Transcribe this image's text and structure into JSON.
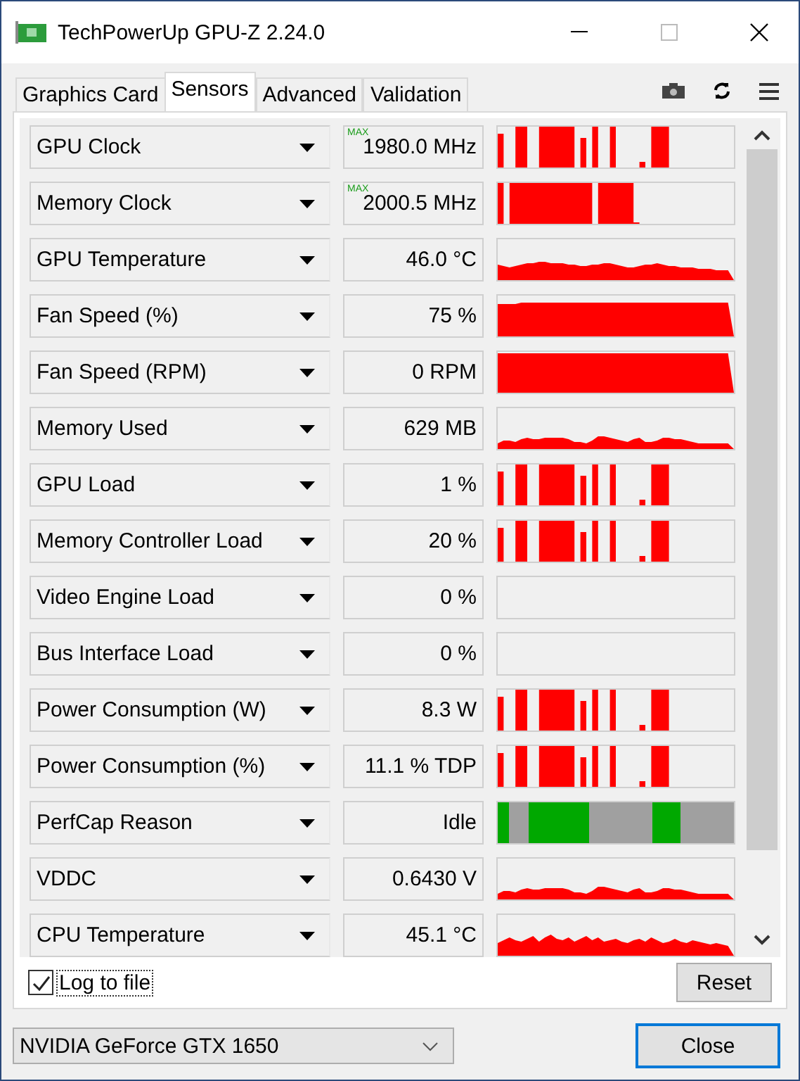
{
  "window": {
    "title": "TechPowerUp GPU-Z 2.24.0"
  },
  "tabs": [
    {
      "label": "Graphics Card",
      "selected": false
    },
    {
      "label": "Sensors",
      "selected": true
    },
    {
      "label": "Advanced",
      "selected": false
    },
    {
      "label": "Validation",
      "selected": false
    }
  ],
  "sensors": [
    {
      "name": "GPU Clock",
      "value": "1980.0 MHz",
      "badge": "MAX"
    },
    {
      "name": "Memory Clock",
      "value": "2000.5 MHz",
      "badge": "MAX"
    },
    {
      "name": "GPU Temperature",
      "value": "46.0 °C"
    },
    {
      "name": "Fan Speed (%)",
      "value": "75 %"
    },
    {
      "name": "Fan Speed (RPM)",
      "value": "0 RPM"
    },
    {
      "name": "Memory Used",
      "value": "629 MB"
    },
    {
      "name": "GPU Load",
      "value": "1 %"
    },
    {
      "name": "Memory Controller Load",
      "value": "20 %"
    },
    {
      "name": "Video Engine Load",
      "value": "0 %"
    },
    {
      "name": "Bus Interface Load",
      "value": "0 %"
    },
    {
      "name": "Power Consumption (W)",
      "value": "8.3 W"
    },
    {
      "name": "Power Consumption (%)",
      "value": "11.1 % TDP"
    },
    {
      "name": "PerfCap Reason",
      "value": "Idle"
    },
    {
      "name": "VDDC",
      "value": "0.6430 V"
    },
    {
      "name": "CPU Temperature",
      "value": "45.1 °C"
    }
  ],
  "log_to_file": {
    "label": "Log to file",
    "checked": true
  },
  "reset_button": "Reset",
  "device_select": {
    "value": "NVIDIA GeForce GTX 1650"
  },
  "close_button": "Close"
}
